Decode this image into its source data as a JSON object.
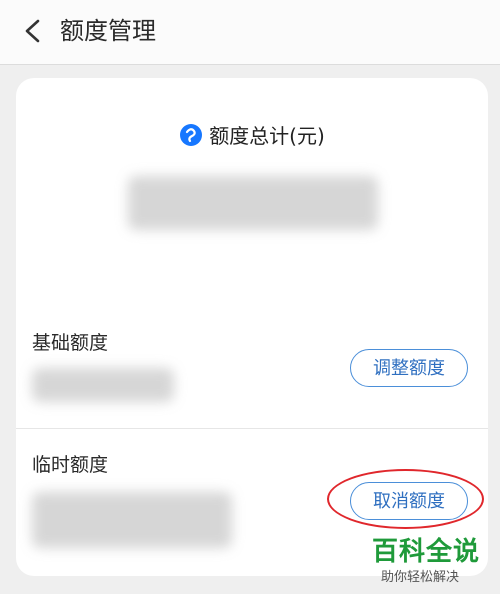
{
  "header": {
    "title": "额度管理",
    "back_icon": "chevron-left-icon"
  },
  "card": {
    "total_label": "额度总计(元)",
    "brand_icon": "alipay-bubble-icon",
    "base_label": "基础额度",
    "adjust_button": "调整额度",
    "temp_label": "临时额度",
    "cancel_button": "取消额度"
  },
  "watermark": {
    "main": "百科全说",
    "sub": "助你轻松解决"
  },
  "colors": {
    "accent": "#4b8fd9",
    "highlight": "#e0272c",
    "watermark": "#1f9a3a"
  }
}
